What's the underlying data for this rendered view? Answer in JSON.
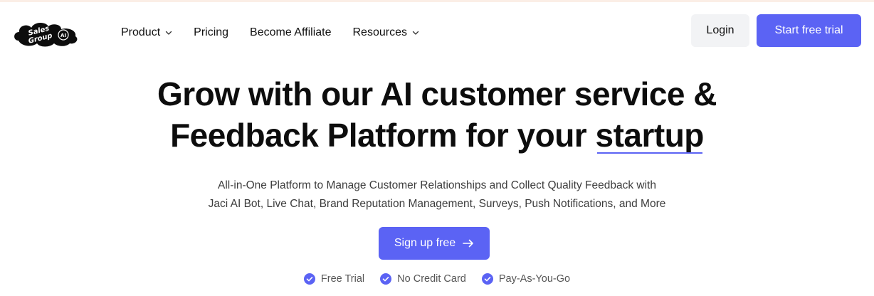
{
  "brand": {
    "logo_icon": "sales-group-ai-cloud-logo",
    "logo_text_line1": "Sales",
    "logo_text_line2": "Group",
    "logo_badge": "AI"
  },
  "nav": {
    "items": [
      {
        "label": "Product",
        "has_dropdown": true
      },
      {
        "label": "Pricing",
        "has_dropdown": false
      },
      {
        "label": "Become Affiliate",
        "has_dropdown": false
      },
      {
        "label": "Resources",
        "has_dropdown": true
      }
    ],
    "dropdown_icon": "chevron-down-icon"
  },
  "header_actions": {
    "login_label": "Login",
    "trial_label": "Start free trial"
  },
  "hero": {
    "title_line1": "Grow with our AI customer service &",
    "title_line2_prefix": "Feedback Platform for your ",
    "title_highlight": "startup",
    "subtitle_line1": "All-in-One Platform to Manage Customer Relationships and Collect Quality Feedback with",
    "subtitle_line2": "Jaci AI Bot, Live Chat, Brand Reputation Management, Surveys, Push Notifications, and More",
    "cta_label": "Sign up free",
    "cta_icon": "arrow-right-icon"
  },
  "features": [
    {
      "label": "Free Trial",
      "icon": "check-circle-icon"
    },
    {
      "label": "No Credit Card",
      "icon": "check-circle-icon"
    },
    {
      "label": "Pay-As-You-Go",
      "icon": "check-circle-icon"
    }
  ],
  "colors": {
    "accent": "#5b63f4",
    "text": "#111111",
    "muted": "#555555",
    "login_bg": "#f2f3f5"
  }
}
